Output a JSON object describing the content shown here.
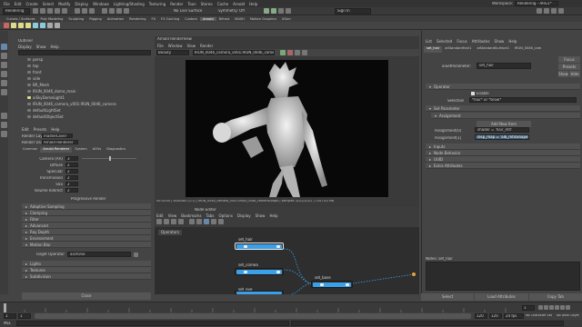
{
  "app": {
    "title": "Maya",
    "workspace_label": "Workspace:",
    "workspace_value": "Rendering - ARG1*"
  },
  "menubar": {
    "items": [
      "File",
      "Edit",
      "Create",
      "Select",
      "Modify",
      "Display",
      "Windows",
      "Lighting/Shading",
      "Texturing",
      "Render",
      "Toon",
      "Stereo",
      "Cache",
      "Arnold",
      "Help"
    ]
  },
  "status_line": {
    "mode": "Rendering",
    "symmetry": "Symmetry: Off",
    "no_live_surface": "No Live Surface",
    "sign_in": "Sign In"
  },
  "shelf_tabs": [
    "Curves / Surfaces",
    "Poly Modeling",
    "Sculpting",
    "Rigging",
    "Animation",
    "Rendering",
    "FX",
    "FX Caching",
    "Custom",
    "Arnold",
    "Bifrost",
    "MASH",
    "Motion Graphics",
    "XGen"
  ],
  "shelf_active_tab": "Arnold",
  "outliner": {
    "title": "Outliner",
    "menu": [
      "Display",
      "Show",
      "Help"
    ],
    "search_placeholder": "Search...",
    "items": [
      {
        "label": "persp",
        "indent": 1
      },
      {
        "label": "top",
        "indent": 1
      },
      {
        "label": "front",
        "indent": 1
      },
      {
        "label": "side",
        "indent": 1
      },
      {
        "label": "BR_Mesh",
        "indent": 1
      },
      {
        "label": "IRUN_0046_dome_main",
        "indent": 1
      },
      {
        "label": "aiSkyDomeLight1",
        "indent": 1
      },
      {
        "label": "IRUN_0046_camera_v001:IRUN_0046_camera",
        "indent": 1
      },
      {
        "label": "defaultLightSet",
        "indent": 1
      },
      {
        "label": "defaultObjectSet",
        "indent": 1
      }
    ]
  },
  "render_settings": {
    "menu": [
      "Edit",
      "Presets",
      "Help"
    ],
    "render_layer_label": "Render Layer",
    "render_layer_value": "masterLayer",
    "render_using_label": "Render Using",
    "render_using_value": "Arnold Renderer",
    "tabs": [
      "Common",
      "Arnold Renderer",
      "System",
      "AOVs",
      "Diagnostics"
    ],
    "active_tab": "Arnold Renderer",
    "fields": [
      {
        "label": "Camera (AA)",
        "value": "3"
      },
      {
        "label": "Diffuse",
        "value": "2"
      },
      {
        "label": "Specular",
        "value": "2"
      },
      {
        "label": "Transmission",
        "value": "2"
      },
      {
        "label": "SSS",
        "value": "2"
      },
      {
        "label": "Volume Indirect",
        "value": "2"
      }
    ],
    "progressive_label": "Progressive Render",
    "sections": [
      "Adaptive Sampling",
      "Clamping",
      "Filter",
      "Advanced",
      "Ray Depth",
      "Environment",
      "Motion Blur",
      "Lights",
      "Textures",
      "Subdivision"
    ],
    "open_section": "Motion Blur",
    "target_operator_label": "Target Operator",
    "target_operator_value": "aiOrOne",
    "close_label": "Close"
  },
  "render_view": {
    "title": "Arnold RenderView",
    "menu": [
      "File",
      "Window",
      "View",
      "Render"
    ],
    "camera_select": "Beauty",
    "camera_path": "IRUN_0046_camera_v001:IRUN_0046_cameraShape",
    "status_text": "00:00:00 | 640x360 (1:1) | IRUN_0046_camera_v001:IRUN_0046_cameraShape | samples 3/2/2/2/2/2 | 1347.83 MB"
  },
  "node_editor": {
    "tab": "Node Editor",
    "menu": [
      "Edit",
      "View",
      "Bookmarks",
      "Tabs",
      "Options",
      "Display",
      "Show",
      "Help"
    ],
    "subtab": "Operators",
    "nodes": [
      {
        "label": "set_hair",
        "color": "#3aa0e8",
        "selected": true
      },
      {
        "label": "set_cornea",
        "color": "#3aa0e8",
        "selected": false
      },
      {
        "label": "set_base",
        "color": "#3aa0e8",
        "selected": false
      },
      {
        "label": "set_eye",
        "color": "#3aa0e8",
        "selected": false
      }
    ]
  },
  "attribute_editor": {
    "tabs": [
      "List",
      "Selected",
      "Focus",
      "Attributes",
      "Show",
      "Help"
    ],
    "node_tabs": [
      "set_hair",
      "aiStandardHair1",
      "aiStandardSurface1",
      "IRUN_0046_cam"
    ],
    "node_type_label": "aiSetParameter:",
    "node_name": "set_hair",
    "buttons": [
      "Focus",
      "Presets",
      "Show",
      "Hide"
    ],
    "operator_section": "Operator",
    "enable_label": "Enable",
    "selection_label": "Selection",
    "selection_value": "*hair* or *brow*",
    "set_parameter_section": "Set Parameter",
    "assignment_section": "Assignment",
    "add_new_item": "Add New Item",
    "assignment_rows": [
      {
        "label": "Assignment[0]",
        "value": "shader = 'hair_mtl'"
      },
      {
        "label": "Assignment[1]",
        "value": "disp_map = 'alb_mtlsShape'"
      }
    ],
    "collapsed_sections": [
      "Inputs",
      "Node Behavior",
      "UUID",
      "Extra Attributes"
    ],
    "notes_label": "Notes:",
    "notes_value": "set_hair",
    "bottom_buttons": [
      "Select",
      "Load Attributes",
      "Copy Tab"
    ]
  },
  "timeline": {
    "start": "1",
    "end": "120",
    "current": "1",
    "range_start": "1",
    "range_end": "120",
    "fps": "24 fps",
    "no_character_set": "No Character Set",
    "no_anim_layer": "No Anim Layer"
  },
  "command_line": {
    "label": "MEL"
  },
  "colors": {
    "accent": "#3aa0e8",
    "panel_bg": "#444444",
    "dark_bg": "#2b2b2b",
    "shelf_active": "#5a5a5a"
  }
}
